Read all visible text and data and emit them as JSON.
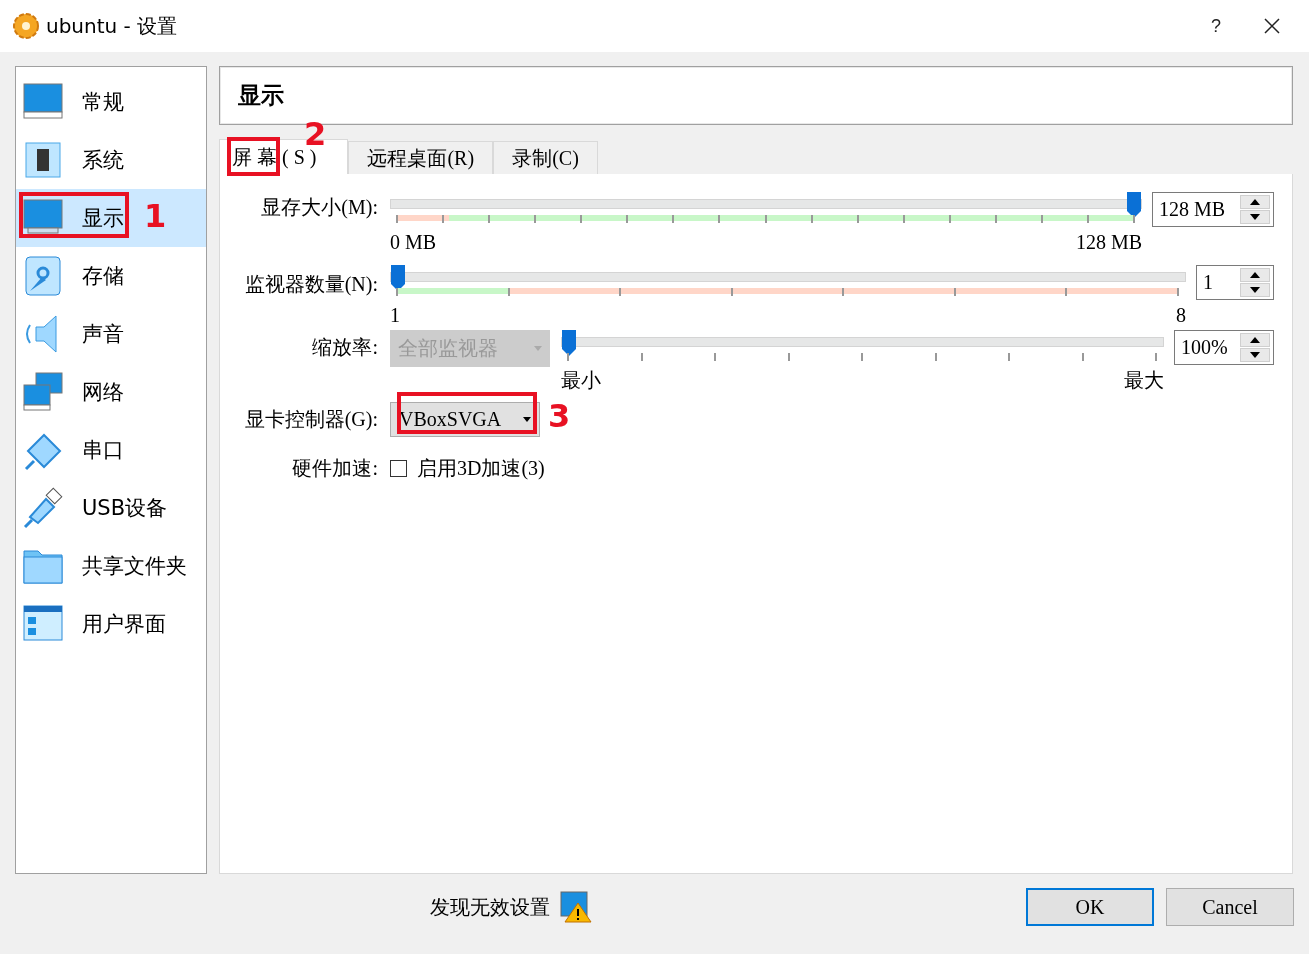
{
  "window": {
    "title": "ubuntu - 设置",
    "help": "?"
  },
  "sidebar": {
    "items": [
      {
        "label": "常规",
        "selected": false
      },
      {
        "label": "系统",
        "selected": false
      },
      {
        "label": "显示",
        "selected": true
      },
      {
        "label": "存储",
        "selected": false
      },
      {
        "label": "声音",
        "selected": false
      },
      {
        "label": "网络",
        "selected": false
      },
      {
        "label": "串口",
        "selected": false
      },
      {
        "label": "USB设备",
        "selected": false
      },
      {
        "label": "共享文件夹",
        "selected": false
      },
      {
        "label": "用户界面",
        "selected": false
      }
    ]
  },
  "page_title": "显示",
  "tabs": [
    {
      "label": "屏幕(S)",
      "selected": true
    },
    {
      "label": "远程桌面(R)",
      "selected": false
    },
    {
      "label": "录制(C)",
      "selected": false
    }
  ],
  "video_memory": {
    "label": "显存大小(M):",
    "level": 1,
    "min_label": "0 MB",
    "max_label": "128 MB",
    "value": "128 MB",
    "band": [
      {
        "color": "#ffd6c8",
        "level": 0.07
      },
      {
        "color": "#c8f7c8",
        "level": 0.93
      }
    ]
  },
  "monitor_count": {
    "label": "监视器数量(N):",
    "level": 0,
    "min_label": "1",
    "max_label": "8",
    "value": "1",
    "band": [
      {
        "color": "#c8f7c8",
        "level": 0.143
      },
      {
        "color": "#ffd6c8",
        "level": 0.857
      }
    ]
  },
  "scale_factor": {
    "label": "缩放率:",
    "dropdown": "全部监视器",
    "level": 0,
    "min_label": "最小",
    "max_label": "最大",
    "value": "100%"
  },
  "graphics_controller": {
    "label": "显卡控制器(G):",
    "value": "VBoxSVGA"
  },
  "acceleration": {
    "label": "硬件加速:",
    "checkbox": "启用3D加速(3)",
    "checked": false
  },
  "footer": {
    "warning": "发现无效设置",
    "buttons": [
      {
        "label": "OK",
        "selected": true
      },
      {
        "label": "Cancel",
        "selected": false
      }
    ]
  },
  "annotations": [
    {
      "label": "1"
    },
    {
      "label": "2"
    },
    {
      "label": "3"
    }
  ]
}
